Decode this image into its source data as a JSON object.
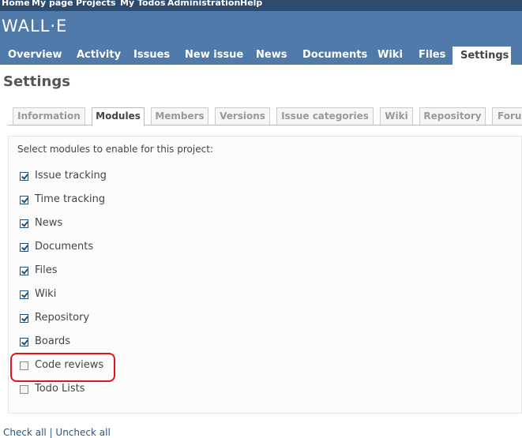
{
  "top_menu": {
    "items": [
      "Home",
      "My page",
      "Projects",
      "My Todos",
      "Administration",
      "Help"
    ]
  },
  "header": {
    "project_title": "WALL·E"
  },
  "main_menu": {
    "tabs": [
      "Overview",
      "Activity",
      "Issues",
      "New issue",
      "News",
      "Documents",
      "Wiki",
      "Files",
      "Settings"
    ],
    "selected": "Settings"
  },
  "page": {
    "title": "Settings"
  },
  "settings_tabs": {
    "tabs": [
      "Information",
      "Modules",
      "Members",
      "Versions",
      "Issue categories",
      "Wiki",
      "Repository",
      "Foru"
    ],
    "selected": "Modules"
  },
  "modules": {
    "legend": "Select modules to enable for this project:",
    "items": [
      {
        "label": "Issue tracking",
        "checked": true
      },
      {
        "label": "Time tracking",
        "checked": true
      },
      {
        "label": "News",
        "checked": true
      },
      {
        "label": "Documents",
        "checked": true
      },
      {
        "label": "Files",
        "checked": true
      },
      {
        "label": "Wiki",
        "checked": true
      },
      {
        "label": "Repository",
        "checked": true
      },
      {
        "label": "Boards",
        "checked": true
      },
      {
        "label": "Code reviews",
        "checked": false
      },
      {
        "label": "Todo Lists",
        "checked": false
      }
    ]
  },
  "annotation": {
    "highlight_color": "#e0141e",
    "highlighted_item": "Code reviews"
  },
  "footer": {
    "partial_link": "Check all | Uncheck all"
  },
  "colors": {
    "top_bar": "#2c4b6f",
    "header": "#507aaa",
    "link": "#2a5685"
  }
}
